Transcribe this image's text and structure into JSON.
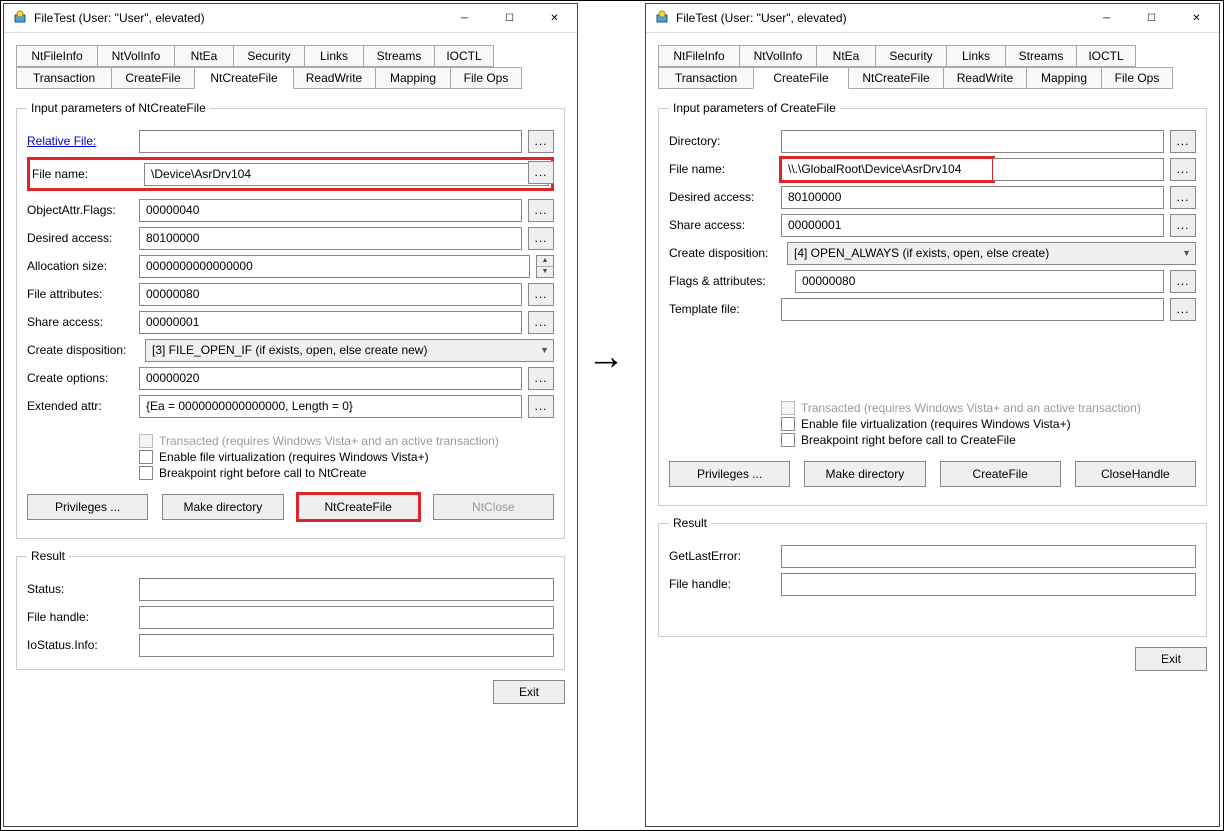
{
  "window_title": "FileTest (User: \"User\", elevated)",
  "tabs_row1": [
    "NtFileInfo",
    "NtVolInfo",
    "NtEa",
    "Security",
    "Links",
    "Streams",
    "IOCTL"
  ],
  "tabs_row2": [
    "Transaction",
    "CreateFile",
    "NtCreateFile",
    "ReadWrite",
    "Mapping",
    "File Ops"
  ],
  "left": {
    "active_tab": "NtCreateFile",
    "group_title": "Input parameters of NtCreateFile",
    "relative_file_label": "Relative File:",
    "relative_file_val": "",
    "file_name_label": "File name:",
    "file_name_val": "\\Device\\AsrDrv104",
    "object_attr_label": "ObjectAttr.Flags:",
    "object_attr_val": "00000040",
    "desired_access_label": "Desired access:",
    "desired_access_val": "80100000",
    "alloc_size_label": "Allocation size:",
    "alloc_size_val": "0000000000000000",
    "file_attr_label": "File attributes:",
    "file_attr_val": "00000080",
    "share_access_label": "Share access:",
    "share_access_val": "00000001",
    "create_disp_label": "Create disposition:",
    "create_disp_val": "[3] FILE_OPEN_IF (if exists, open, else create new)",
    "create_opts_label": "Create options:",
    "create_opts_val": "00000020",
    "ext_attr_label": "Extended attr:",
    "ext_attr_val": "{Ea = 0000000000000000, Length = 0}",
    "chk_transacted": "Transacted (requires Windows Vista+ and an active transaction)",
    "chk_virt": "Enable file virtualization (requires Windows Vista+)",
    "chk_bp": "Breakpoint right before call to NtCreate",
    "btn_priv": "Privileges ...",
    "btn_mkdir": "Make directory",
    "btn_main": "NtCreateFile",
    "btn_close": "NtClose",
    "result_title": "Result",
    "status_label": "Status:",
    "handle_label": "File handle:",
    "io_label": "IoStatus.Info:"
  },
  "right": {
    "active_tab": "CreateFile",
    "group_title": "Input parameters of CreateFile",
    "directory_label": "Directory:",
    "directory_val": "",
    "file_name_label": "File name:",
    "file_name_val": "\\\\.\\GlobalRoot\\Device\\AsrDrv104",
    "desired_access_label": "Desired access:",
    "desired_access_val": "80100000",
    "share_access_label": "Share access:",
    "share_access_val": "00000001",
    "create_disp_label": "Create disposition:",
    "create_disp_val": "[4] OPEN_ALWAYS (if exists, open, else create)",
    "flags_attr_label": "Flags & attributes:",
    "flags_attr_val": "00000080",
    "template_label": "Template file:",
    "template_val": "",
    "chk_transacted": "Transacted (requires Windows Vista+ and an active transaction)",
    "chk_virt": "Enable file virtualization (requires Windows Vista+)",
    "chk_bp": "Breakpoint right before call to CreateFile",
    "btn_priv": "Privileges ...",
    "btn_mkdir": "Make directory",
    "btn_main": "CreateFile",
    "btn_close": "CloseHandle",
    "result_title": "Result",
    "gle_label": "GetLastError:",
    "handle_label": "File handle:"
  },
  "exit_label": "Exit"
}
